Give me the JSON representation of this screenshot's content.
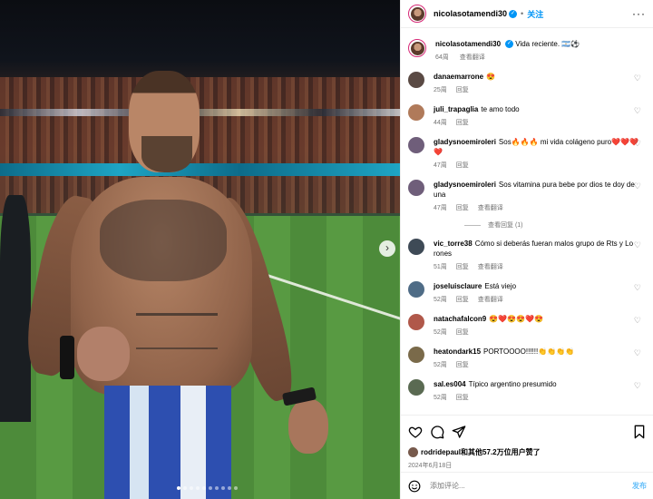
{
  "header": {
    "username": "nicolasotamendi30",
    "follow_label": "关注",
    "more_label": "···"
  },
  "caption": {
    "username": "nicolasotamendi30",
    "text": "Vida reciente. 🇦🇷⚽",
    "time": "64周",
    "translate": "查看翻译"
  },
  "comments": [
    {
      "username": "danaemarrone",
      "text": "😍",
      "time": "25周",
      "reply": "回复",
      "translate": ""
    },
    {
      "username": "juli_trapaglia",
      "text": "te amo todo",
      "time": "44周",
      "reply": "回复",
      "translate": ""
    },
    {
      "username": "gladysnoemiroleri",
      "text": "Sos🔥🔥🔥 mi vida colágeno puro❤️❤️❤️❤️",
      "time": "47周",
      "reply": "回复",
      "translate": ""
    },
    {
      "username": "gladysnoemiroleri",
      "text": "Sos vitamina pura bebe por dios te doy de una",
      "time": "47周",
      "reply": "回复",
      "translate": "查看翻译",
      "view_replies": "查看回复 (1)"
    },
    {
      "username": "vic_torre38",
      "text": "Cómo si deberás fueran malos grupo de Rts y Lo rones",
      "time": "51周",
      "reply": "回复",
      "translate": "查看翻译"
    },
    {
      "username": "joseluisclaure",
      "text": "Está viejo",
      "time": "52周",
      "reply": "回复",
      "translate": "查看翻译"
    },
    {
      "username": "natachafalcon9",
      "text": "😍❤️😍😍❤️😍",
      "time": "52周",
      "reply": "回复",
      "translate": ""
    },
    {
      "username": "heatondark15",
      "text": "PORTOOOO!!!!!!👏👏👏👏",
      "time": "52周",
      "reply": "回复",
      "translate": ""
    },
    {
      "username": "sal.es004",
      "text": "Típico argentino presumido",
      "time": "52周",
      "reply": "回复",
      "translate": ""
    }
  ],
  "likes": {
    "user": "rodridepaul",
    "text": "和其他57.2万位用户赞了"
  },
  "date": "2024年6月18日",
  "composer": {
    "placeholder": "添加评论...",
    "post_label": "发布"
  },
  "colors": {
    "link": "#0095f6",
    "verified": "#0095f6",
    "meta": "#737373"
  },
  "icons": {
    "like": "heart-icon",
    "comment": "comment-icon",
    "share": "share-icon",
    "save": "bookmark-icon",
    "more": "more-icon",
    "emoji": "emoji-icon",
    "next": "chevron-right-icon"
  }
}
